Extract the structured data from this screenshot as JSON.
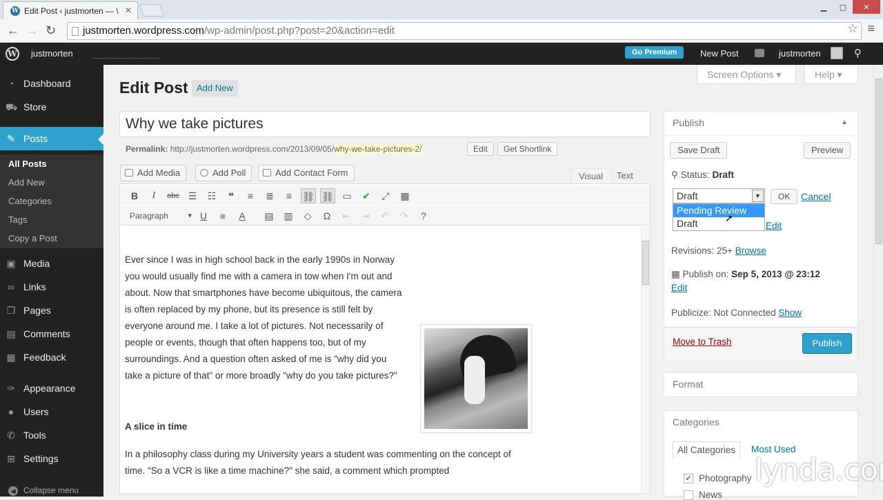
{
  "browser": {
    "tab_title": "Edit Post ‹ justmorten — \\",
    "url_host": "justmorten.wordpress.com",
    "url_path": "/wp-admin/post.php?post=20&action=edit"
  },
  "adminbar": {
    "site_name": "justmorten",
    "go_premium": "Go Premium",
    "new_post": "New Post",
    "user": "justmorten"
  },
  "sidebar": {
    "items": [
      {
        "label": "Dashboard",
        "icon": "dashboard-icon"
      },
      {
        "label": "Store",
        "icon": "cart-icon"
      },
      {
        "label": "Posts",
        "icon": "pin-icon"
      },
      {
        "label": "Media",
        "icon": "media-icon"
      },
      {
        "label": "Links",
        "icon": "link-icon"
      },
      {
        "label": "Pages",
        "icon": "pages-icon"
      },
      {
        "label": "Comments",
        "icon": "comments-icon"
      },
      {
        "label": "Feedback",
        "icon": "feedback-icon"
      },
      {
        "label": "Appearance",
        "icon": "brush-icon"
      },
      {
        "label": "Users",
        "icon": "users-icon"
      },
      {
        "label": "Tools",
        "icon": "wrench-icon"
      },
      {
        "label": "Settings",
        "icon": "settings-icon"
      }
    ],
    "submenu": [
      "All Posts",
      "Add New",
      "Categories",
      "Tags",
      "Copy a Post"
    ],
    "collapse": "Collapse menu"
  },
  "screen_options": "Screen Options ▾",
  "help": "Help ▾",
  "page": {
    "title": "Edit Post",
    "add_new": "Add New",
    "post_title": "Why we take pictures",
    "permalink_label": "Permalink:",
    "permalink_base": "http://justmorten.wordpress.com/2013/09/05/",
    "permalink_slug": "why-we-take-pictures-2/",
    "edit_btn": "Edit",
    "shortlink_btn": "Get Shortlink"
  },
  "media_buttons": [
    "Add Media",
    "Add Poll",
    "Add Contact Form"
  ],
  "editor_tabs": {
    "visual": "Visual",
    "text": "Text"
  },
  "editor": {
    "format": "Paragraph",
    "para1": "Ever since I was in high school back in the early 1990s in Norway you would usually find me with a camera in tow when I'm out and about. Now that smartphones have become ubiquitous, the camera is often replaced by my phone, but its presence is still felt by everyone around me. I take a lot of pictures. Not necessarily of people or events, though that often happens too, but of my surroundings. And a question often asked of me is \"why did you take a picture of that\" or more broadly \"why do you take pictures?\"",
    "heading": "A slice in time",
    "para2": "In a philosophy class during my University years a student was commenting on the concept of time. \"So a VCR is like a time machine?\" she said, a comment which prompted"
  },
  "publish": {
    "title": "Publish",
    "save_draft": "Save Draft",
    "preview": "Preview",
    "status_label": "Status:",
    "status_value": "Draft",
    "select_value": "Draft",
    "ok": "OK",
    "cancel": "Cancel",
    "options": [
      "Pending Review",
      "Draft"
    ],
    "visibility_edit": "Edit",
    "revisions_label": "Revisions: 25+",
    "browse": "Browse",
    "publish_on_label": "Publish on:",
    "publish_on_value": "Sep 5, 2013 @ 23:12",
    "edit": "Edit",
    "publicize": "Publicize: Not Connected",
    "show": "Show",
    "trash": "Move to Trash",
    "publish_btn": "Publish"
  },
  "format_box": {
    "title": "Format"
  },
  "categories": {
    "title": "Categories",
    "tab_all": "All Categories",
    "tab_used": "Most Used",
    "items": [
      "Photography",
      "News"
    ]
  },
  "watermark": "lynda.com"
}
